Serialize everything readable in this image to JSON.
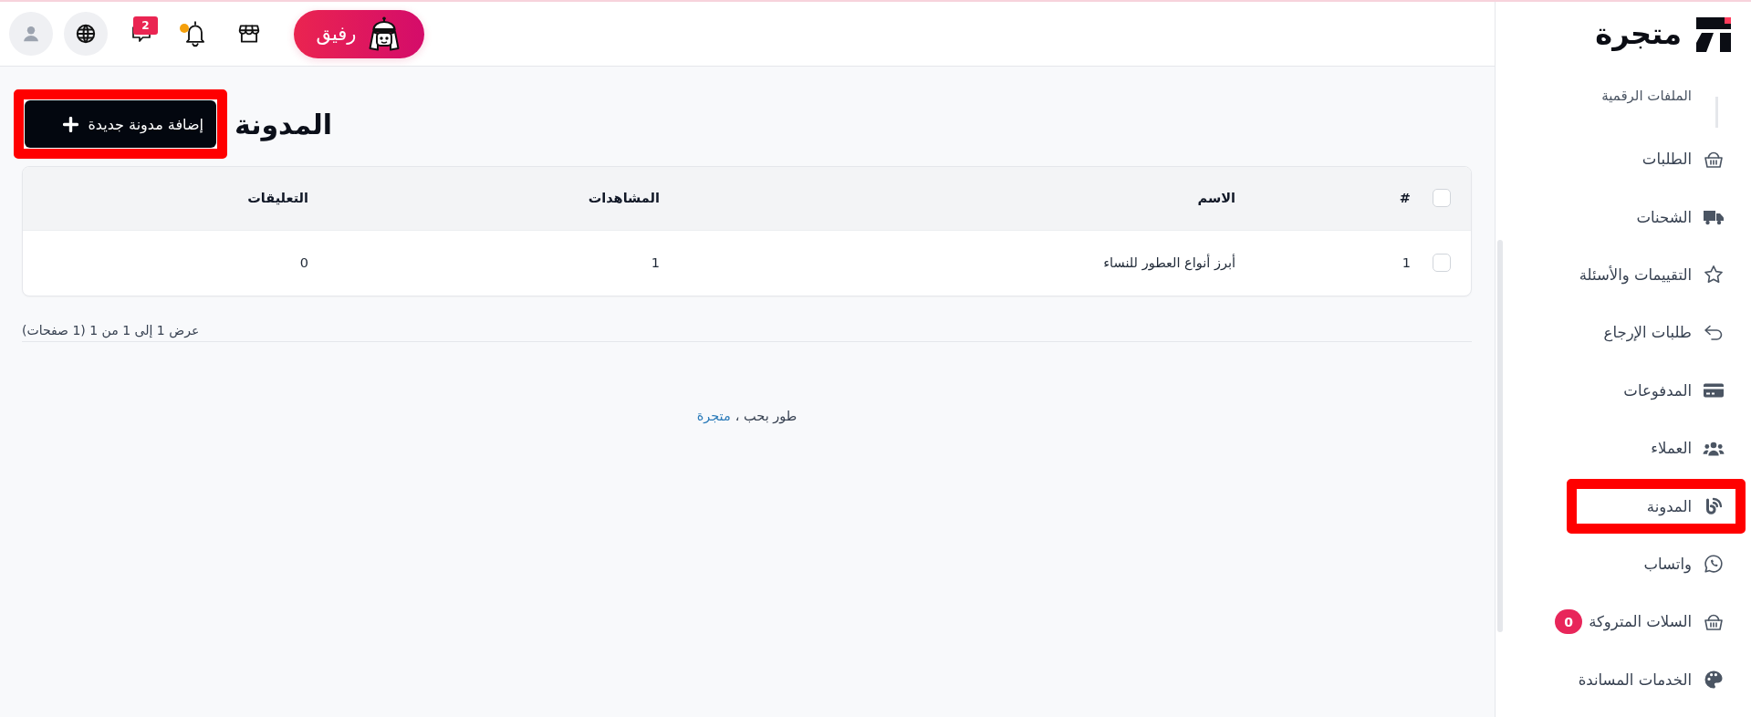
{
  "top_bar": {
    "assistant_button": {
      "label": "رفيق"
    },
    "messages": {
      "badge": "2"
    },
    "notifications": {
      "unread": true
    }
  },
  "sidebar": {
    "brand": "متجرة",
    "items": [
      {
        "label": "الملفات الرقمية",
        "kind": "subitem",
        "highlighted": false
      },
      {
        "label": "الطلبات",
        "kind": "link",
        "highlighted": false
      },
      {
        "label": "الشحنات",
        "kind": "link",
        "highlighted": false
      },
      {
        "label": "التقييمات والأسئلة",
        "kind": "link",
        "highlighted": false
      },
      {
        "label": "طلبات الإرجاع",
        "kind": "link",
        "highlighted": false
      },
      {
        "label": "المدفوعات",
        "kind": "link",
        "highlighted": false
      },
      {
        "label": "العملاء",
        "kind": "link",
        "highlighted": false
      },
      {
        "label": "المدونة",
        "kind": "link",
        "highlighted": true
      },
      {
        "label": "واتساب",
        "kind": "link",
        "highlighted": false
      },
      {
        "label": "السلات المتروكة",
        "kind": "link",
        "highlighted": false,
        "badge": "0"
      },
      {
        "label": "الخدمات المساندة",
        "kind": "link",
        "highlighted": false
      }
    ]
  },
  "page_header": {
    "title": "المدونة",
    "add_button": {
      "label": "إضافة مدونة جديدة",
      "highlighted": true
    }
  },
  "table": {
    "all_checked": false,
    "columns": [
      "#",
      "الاسم",
      "المشاهدات",
      "التعليقات"
    ],
    "rows": [
      {
        "checked": false,
        "cells": [
          "1",
          "أبرز أنواع العطور للنساء",
          "1",
          "0"
        ]
      }
    ]
  },
  "pagination": {
    "summary": "عرض 1 إلى 1 من 1 (1 صفحات)"
  },
  "footer": {
    "text": "طور بحب ،",
    "link": "متجرة"
  }
}
